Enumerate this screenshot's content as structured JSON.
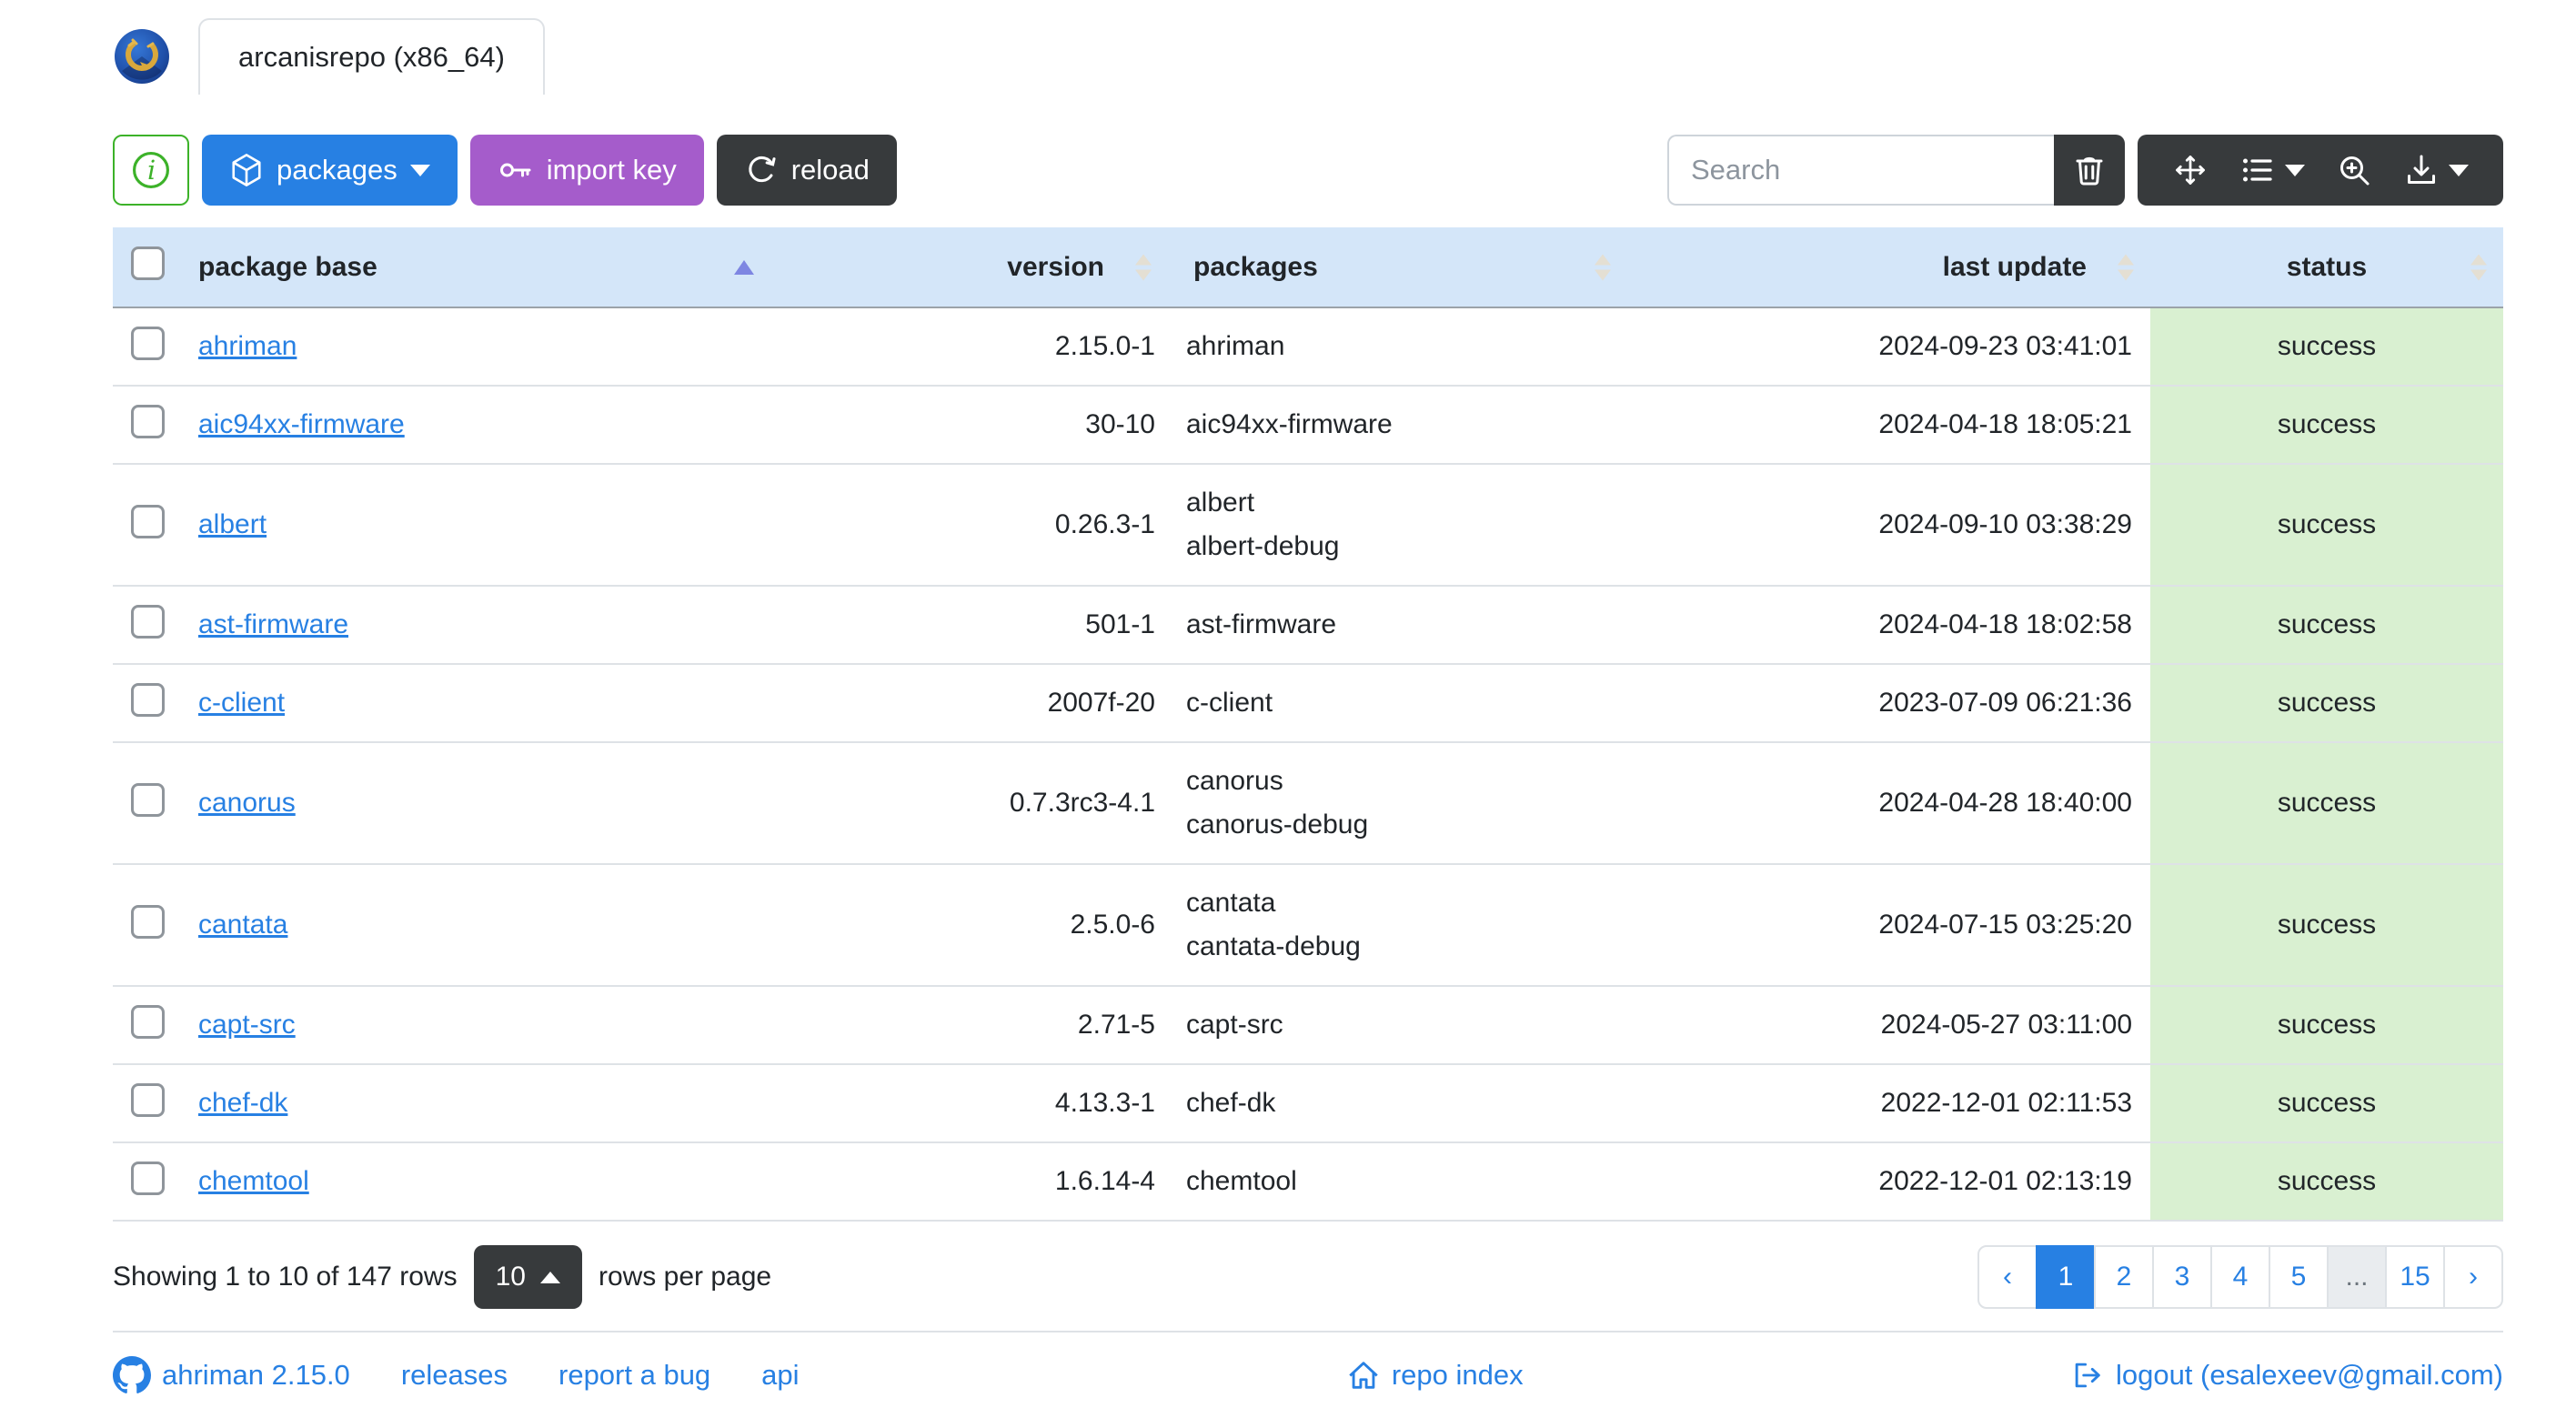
{
  "window": {
    "tab_title": "arcanisrepo (x86_64)"
  },
  "toolbar": {
    "info_button_icon": "info-circle",
    "packages_label": "packages",
    "import_key_label": "import key",
    "reload_label": "reload",
    "search_placeholder": "Search",
    "icons": [
      "trash-icon",
      "arrows-move-icon",
      "columns-list-icon",
      "zoom-in-icon",
      "download-icon"
    ]
  },
  "table": {
    "columns": [
      {
        "label": "package base",
        "sort": "asc"
      },
      {
        "label": "version",
        "sort": "none"
      },
      {
        "label": "packages",
        "sort": "none"
      },
      {
        "label": "last update",
        "sort": "none"
      },
      {
        "label": "status",
        "sort": "none"
      }
    ],
    "rows": [
      {
        "base": "ahriman",
        "version": "2.15.0-1",
        "packages": [
          "ahriman"
        ],
        "last_update": "2024-09-23 03:41:01",
        "status": "success"
      },
      {
        "base": "aic94xx-firmware",
        "version": "30-10",
        "packages": [
          "aic94xx-firmware"
        ],
        "last_update": "2024-04-18 18:05:21",
        "status": "success"
      },
      {
        "base": "albert",
        "version": "0.26.3-1",
        "packages": [
          "albert",
          "albert-debug"
        ],
        "last_update": "2024-09-10 03:38:29",
        "status": "success"
      },
      {
        "base": "ast-firmware",
        "version": "501-1",
        "packages": [
          "ast-firmware"
        ],
        "last_update": "2024-04-18 18:02:58",
        "status": "success"
      },
      {
        "base": "c-client",
        "version": "2007f-20",
        "packages": [
          "c-client"
        ],
        "last_update": "2023-07-09 06:21:36",
        "status": "success"
      },
      {
        "base": "canorus",
        "version": "0.7.3rc3-4.1",
        "packages": [
          "canorus",
          "canorus-debug"
        ],
        "last_update": "2024-04-28 18:40:00",
        "status": "success"
      },
      {
        "base": "cantata",
        "version": "2.5.0-6",
        "packages": [
          "cantata",
          "cantata-debug"
        ],
        "last_update": "2024-07-15 03:25:20",
        "status": "success"
      },
      {
        "base": "capt-src",
        "version": "2.71-5",
        "packages": [
          "capt-src"
        ],
        "last_update": "2024-05-27 03:11:00",
        "status": "success"
      },
      {
        "base": "chef-dk",
        "version": "4.13.3-1",
        "packages": [
          "chef-dk"
        ],
        "last_update": "2022-12-01 02:11:53",
        "status": "success"
      },
      {
        "base": "chemtool",
        "version": "1.6.14-4",
        "packages": [
          "chemtool"
        ],
        "last_update": "2022-12-01 02:13:19",
        "status": "success"
      }
    ]
  },
  "pagination": {
    "summary": "Showing 1 to 10 of 147 rows",
    "page_size": "10",
    "rows_per_page_label": "rows per page",
    "prev": "‹",
    "next": "›",
    "pages": [
      "1",
      "2",
      "3",
      "4",
      "5",
      "...",
      "15"
    ],
    "active_page": "1"
  },
  "footer": {
    "version_link": "ahriman 2.15.0",
    "releases_link": "releases",
    "report_bug_link": "report a bug",
    "api_link": "api",
    "repo_index_link": "repo index",
    "logout_link": "logout (esalexeev@gmail.com)"
  },
  "colors": {
    "primary": "#2780e3",
    "info_purple": "#a55ccb",
    "dark": "#373a3c",
    "success_green": "#3cb229",
    "table_header_bg": "#d4e6f9",
    "status_success_bg": "#d9f0d1",
    "active_sort_arrow": "#7e86e2",
    "link": "#2780e3"
  }
}
